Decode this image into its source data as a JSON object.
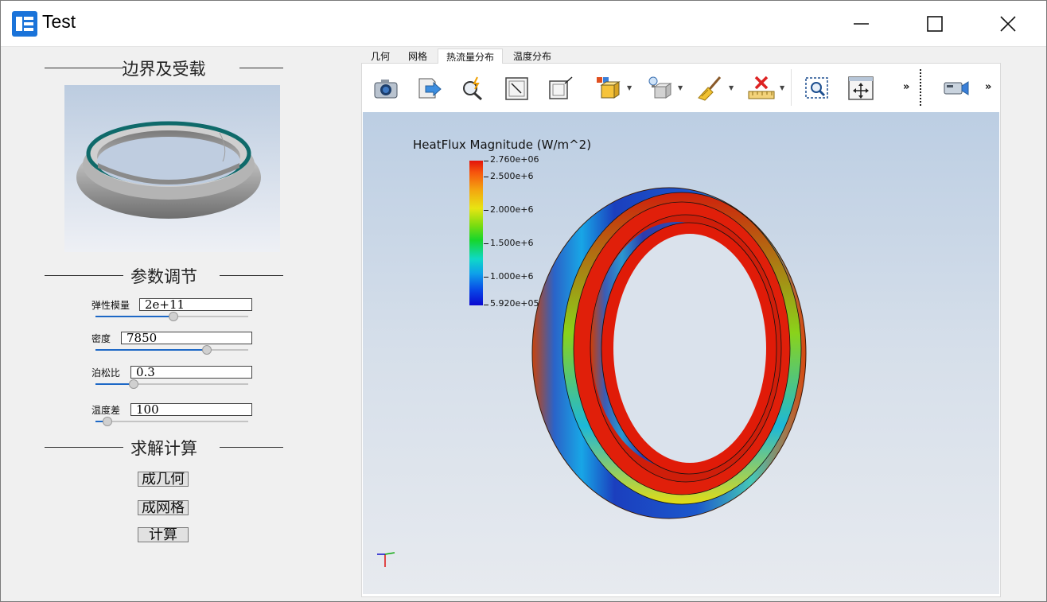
{
  "window": {
    "title": "Test"
  },
  "left_panel": {
    "boundary_section": "边界及受载",
    "params_section": "参数调节",
    "solve_section": "求解计算",
    "params": [
      {
        "label": "弹性模量",
        "value": "2e+11",
        "slider_level": 0.51
      },
      {
        "label": "密度",
        "value": "7850",
        "slider_level": 0.73
      },
      {
        "label": "泊松比",
        "value": "0.3",
        "slider_level": 0.25
      },
      {
        "label": "温度差",
        "value": "100",
        "slider_level": 0.08
      }
    ],
    "buttons": {
      "gen_geometry": "成几何",
      "gen_mesh": "成网格",
      "compute": "计算"
    }
  },
  "tabs": [
    {
      "label": "几何",
      "active": false
    },
    {
      "label": "网格",
      "active": false
    },
    {
      "label": "热流量分布",
      "active": true
    },
    {
      "label": "温度分布",
      "active": false
    }
  ],
  "toolbar": {
    "icons": [
      "camera-icon",
      "export-icon",
      "probe-icon",
      "reset-view-icon",
      "zoom-out-icon",
      "color-blocks-icon",
      "light-bulb-icon",
      "clean-brush-icon",
      "ruler-delete-icon",
      "zoom-box-icon",
      "fit-view-icon",
      "video-camera-icon"
    ],
    "more_label": "»"
  },
  "legend": {
    "title": "HeatFlux Magnitude (W/m^2)",
    "max": "2.760e+06",
    "ticks": [
      "2.500e+6",
      "2.000e+6",
      "1.500e+6",
      "1.000e+6"
    ],
    "min": "5.920e+05"
  },
  "colors": {
    "accent": "#1d68c6",
    "high": "#e2140c",
    "low": "#0a08d0"
  }
}
